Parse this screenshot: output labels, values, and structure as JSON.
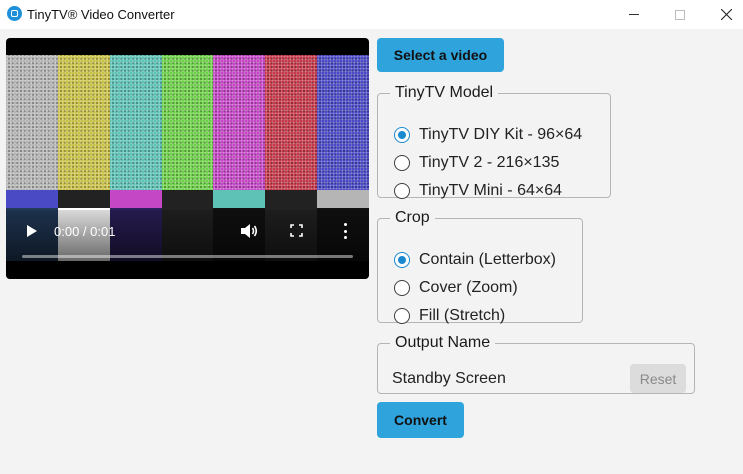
{
  "window": {
    "title": "TinyTV® Video Converter"
  },
  "video": {
    "time": "0:00 / 0:01",
    "progress": 0,
    "bars_top": [
      "#b5b5b5",
      "#c9c14a",
      "#5fc2b6",
      "#6ed04a",
      "#c447c6",
      "#c43a4a",
      "#4a4ac4"
    ],
    "bars_strip": [
      "#4a4ac4",
      "#222222",
      "#c447c6",
      "#222222",
      "#5fc2b6",
      "#222222",
      "#b5b5b5"
    ],
    "bars_lower": [
      "#223a5a",
      "#ffffff",
      "#2c1f5a",
      "#222222",
      "#111111",
      "#222222",
      "#111111"
    ]
  },
  "actions": {
    "select_label": "Select a video",
    "convert_label": "Convert"
  },
  "model": {
    "legend": "TinyTV Model",
    "options": [
      {
        "label": "TinyTV DIY Kit - 96×64",
        "checked": true
      },
      {
        "label": "TinyTV 2 - 216×135",
        "checked": false
      },
      {
        "label": "TinyTV Mini - 64×64",
        "checked": false
      }
    ]
  },
  "crop": {
    "legend": "Crop",
    "options": [
      {
        "label": "Contain (Letterbox)",
        "checked": true
      },
      {
        "label": "Cover (Zoom)",
        "checked": false
      },
      {
        "label": "Fill (Stretch)",
        "checked": false
      }
    ]
  },
  "output": {
    "legend": "Output Name",
    "value": "Standby Screen",
    "reset_label": "Reset"
  },
  "colors": {
    "accent": "#2ea3dc",
    "radio_checked": "#1b88cf"
  }
}
